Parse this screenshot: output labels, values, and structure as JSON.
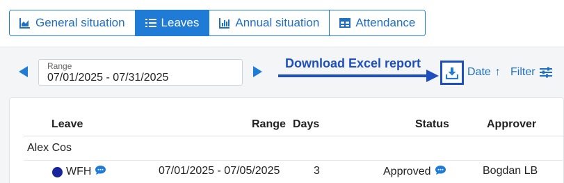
{
  "tabs": [
    {
      "label": "General situation",
      "icon": "area-chart-icon",
      "active": false
    },
    {
      "label": "Leaves",
      "icon": "list-icon",
      "active": true
    },
    {
      "label": "Annual situation",
      "icon": "bar-chart-icon",
      "active": false
    },
    {
      "label": "Attendance",
      "icon": "table-icon",
      "active": false
    }
  ],
  "range": {
    "label": "Range",
    "value": "07/01/2025 - 07/31/2025"
  },
  "annotation": {
    "text": "Download Excel report",
    "color": "#1d4fc0"
  },
  "toolbar": {
    "sort_label": "Date",
    "filter_label": "Filter"
  },
  "table": {
    "headers": {
      "leave": "Leave",
      "range": "Range",
      "days": "Days",
      "status": "Status",
      "approver": "Approver"
    },
    "groups": [
      {
        "name": "Alex Cos",
        "rows": [
          {
            "leave": "WFH",
            "range": "07/01/2025 - 07/05/2025",
            "days": "3",
            "status": "Approved",
            "approver": "Bogdan LB",
            "dot_color": "#18259a"
          }
        ]
      }
    ]
  },
  "colors": {
    "accent": "#1f7bd6",
    "link": "#1f6fc4"
  }
}
